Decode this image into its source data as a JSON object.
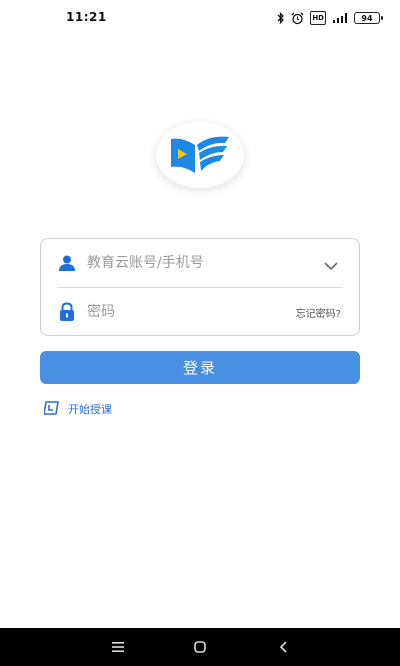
{
  "status_bar": {
    "time": "11:21",
    "battery": "94",
    "hd_label": "HD",
    "icons": [
      "bluetooth-icon",
      "alarm-icon",
      "hd-icon",
      "signal-icon",
      "battery-icon"
    ]
  },
  "logo": {
    "icon": "book-play-logo-icon",
    "colors": {
      "primary": "#1e88e5",
      "accent": "#f5c518"
    }
  },
  "login_form": {
    "account": {
      "placeholder": "教育云账号/手机号",
      "value": "",
      "icon": "user-icon",
      "dropdown_icon": "chevron-down-icon"
    },
    "password": {
      "placeholder": "密码",
      "value": "",
      "icon": "lock-icon"
    },
    "forgot_label": "忘记密码?"
  },
  "login_button": {
    "label": "登录",
    "color": "#4a90e2"
  },
  "start_teaching": {
    "label": "开始授课",
    "icon": "teach-icon"
  },
  "nav_bar": {
    "icons": [
      "menu-icon",
      "home-icon",
      "back-icon"
    ]
  }
}
